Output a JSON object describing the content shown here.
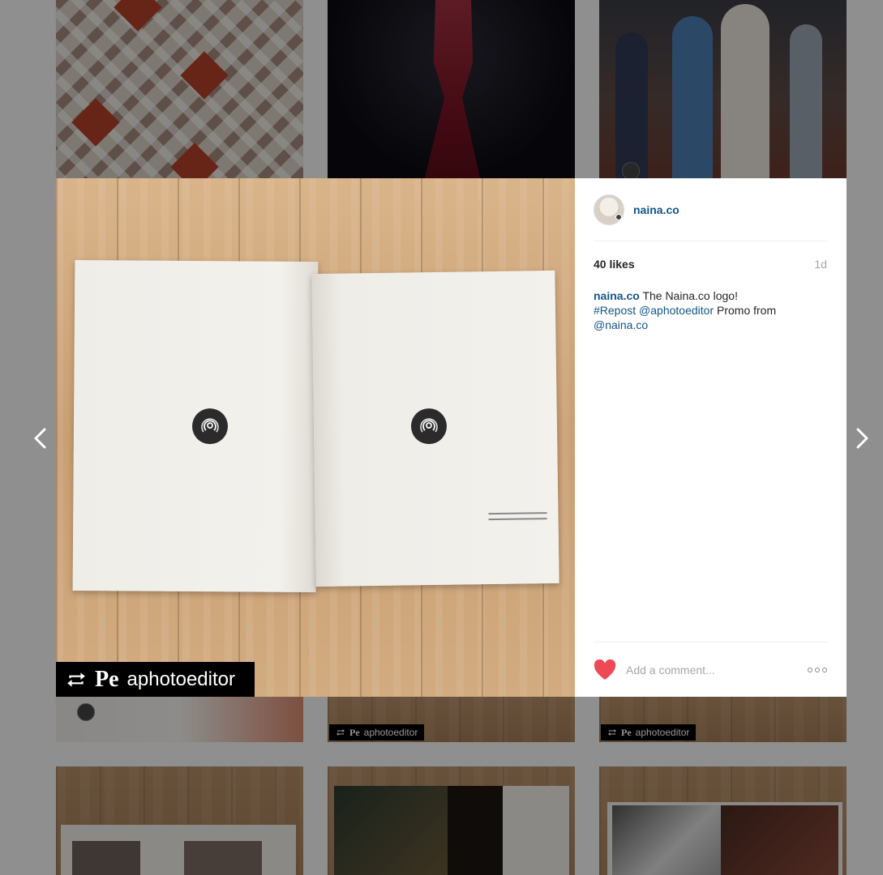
{
  "post": {
    "username": "naina.co",
    "likes": "40 likes",
    "time": "1d",
    "caption_user": "naina.co",
    "caption_text": "The Naina.co logo!",
    "tag_repost": "#Repost",
    "mention_aphotoeditor": "@aphotoeditor",
    "promo_text": "Promo from",
    "mention_naina": "@naina.co"
  },
  "comment": {
    "placeholder": "Add a comment..."
  },
  "badge": {
    "pe": "Pe",
    "handle": "aphotoeditor"
  },
  "thumb_badges": [
    {
      "pe": "Pe",
      "handle": "aphotoeditor"
    },
    {
      "pe": "Pe",
      "handle": "aphotoeditor"
    }
  ],
  "colors": {
    "link": "#125688",
    "heart": "#ed4956",
    "muted": "#a5a7aa"
  },
  "icons": {
    "prev": "chevron-left-icon",
    "next": "chevron-right-icon",
    "heart": "heart-icon",
    "repost": "repost-icon",
    "more": "more-options-icon"
  }
}
